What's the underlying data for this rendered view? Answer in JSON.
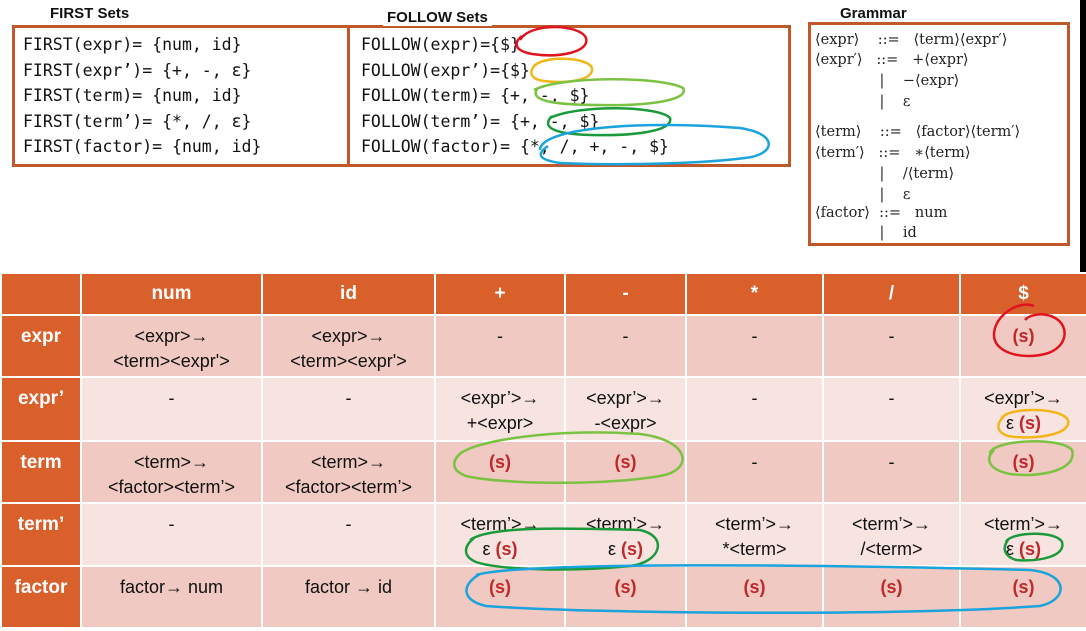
{
  "first_sets": {
    "title": "FIRST Sets",
    "lines": [
      "FIRST(expr)= {num, id}",
      "FIRST(expr’)= {+, -, ε}",
      "FIRST(term)= {num, id}",
      "FIRST(term’)= {*, /, ε}",
      "FIRST(factor)= {num, id}"
    ]
  },
  "follow_sets": {
    "title": "FOLLOW Sets",
    "lines": [
      "FOLLOW(expr)={$}",
      "FOLLOW(expr’)={$}",
      "FOLLOW(term)= {+, -, $}",
      "FOLLOW(term’)= {+, -, $}",
      "FOLLOW(factor)= {*, /, +, -, $}"
    ]
  },
  "grammar": {
    "title": "Grammar",
    "lines": [
      "⟨expr⟩    ::=   ⟨term⟩⟨expr′⟩",
      "⟨expr′⟩   ::=   +⟨expr⟩",
      "              |    −⟨expr⟩",
      "              |    ε",
      "⟨term⟩    ::=   ⟨factor⟩⟨term′⟩",
      "⟨term′⟩   ::=   ∗⟨term⟩",
      "              |    /⟨term⟩",
      "              |    ε",
      "⟨factor⟩  ::=   num",
      "              |    id"
    ]
  },
  "table": {
    "columns": [
      "num",
      "id",
      "+",
      "-",
      "*",
      "/",
      "$"
    ],
    "rows": [
      {
        "label": "expr",
        "cells": [
          [
            "<expr>→",
            "<term><expr'>"
          ],
          [
            "<expr>→",
            "<term><expr'>"
          ],
          [
            "-"
          ],
          [
            "-"
          ],
          [
            "-"
          ],
          [
            "-"
          ],
          [
            "(s)"
          ]
        ]
      },
      {
        "label": "expr’",
        "cells": [
          [
            "-"
          ],
          [
            "-"
          ],
          [
            "<expr’>→",
            "+<expr>"
          ],
          [
            "<expr’>→",
            "-<expr>"
          ],
          [
            "-"
          ],
          [
            "-"
          ],
          [
            "<expr’>→",
            "ε (s)"
          ]
        ]
      },
      {
        "label": "term",
        "cells": [
          [
            "<term>→",
            "<factor><term’>"
          ],
          [
            "<term>→",
            "<factor><term’>"
          ],
          [
            "(s)"
          ],
          [
            "(s)"
          ],
          [
            "-"
          ],
          [
            "-"
          ],
          [
            "(s)"
          ]
        ]
      },
      {
        "label": "term’",
        "cells": [
          [
            "-"
          ],
          [
            "-"
          ],
          [
            "<term’>→",
            "ε (s)"
          ],
          [
            "<term’>→",
            "ε (s)"
          ],
          [
            "<term’>→",
            "*<term>"
          ],
          [
            "<term’>→",
            "/<term>"
          ],
          [
            "<term’>→",
            "ε (s)"
          ]
        ]
      },
      {
        "label": "factor",
        "cells": [
          [
            "factor→ num"
          ],
          [
            "factor → id"
          ],
          [
            "(s)"
          ],
          [
            "(s)"
          ],
          [
            "(s)"
          ],
          [
            "(s)"
          ],
          [
            "(s)"
          ]
        ]
      }
    ]
  },
  "annotation_colors": {
    "red": "#e0141e",
    "yellow": "#f2b51a",
    "light_green": "#7cc242",
    "dark_green": "#1a9a3a",
    "blue": "#1aa3dc"
  }
}
